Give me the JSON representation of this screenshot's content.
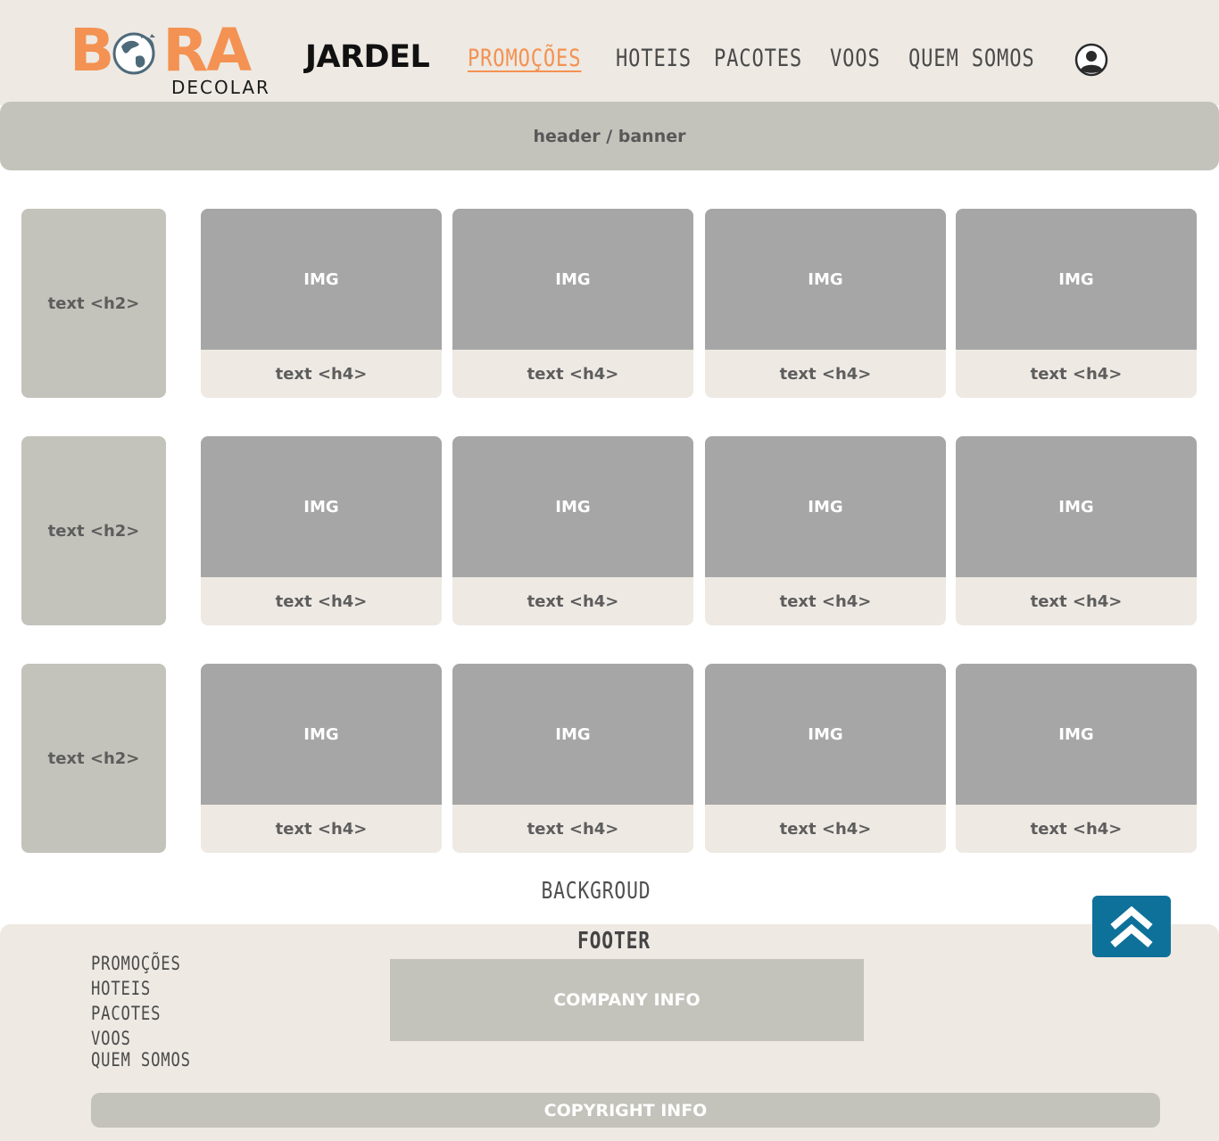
{
  "logo": {
    "word_left": "B",
    "word_right": "RA",
    "sub": "DECOLAR",
    "brand_color": "#f39252"
  },
  "brand": {
    "name": "JARDEL"
  },
  "nav": {
    "items": [
      "PROMOÇÕES",
      "HOTEIS",
      "PACOTES",
      "VOOS",
      "QUEM SOMOS"
    ],
    "active": "PROMOÇÕES",
    "user_icon": "user-circle-icon"
  },
  "banner": {
    "label": "header / banner"
  },
  "rows": [
    {
      "title": "text <h2>",
      "cards": [
        {
          "img": "IMG",
          "caption": "text <h4>"
        },
        {
          "img": "IMG",
          "caption": "text <h4>"
        },
        {
          "img": "IMG",
          "caption": "text <h4>"
        },
        {
          "img": "IMG",
          "caption": "text <h4>"
        }
      ]
    },
    {
      "title": "text <h2>",
      "cards": [
        {
          "img": "IMG",
          "caption": "text <h4>"
        },
        {
          "img": "IMG",
          "caption": "text <h4>"
        },
        {
          "img": "IMG",
          "caption": "text <h4>"
        },
        {
          "img": "IMG",
          "caption": "text <h4>"
        }
      ]
    },
    {
      "title": "text <h2>",
      "cards": [
        {
          "img": "IMG",
          "caption": "text <h4>"
        },
        {
          "img": "IMG",
          "caption": "text <h4>"
        },
        {
          "img": "IMG",
          "caption": "text <h4>"
        },
        {
          "img": "IMG",
          "caption": "text <h4>"
        }
      ]
    }
  ],
  "background_label": "BACKGROUD",
  "footer": {
    "title": "FOOTER",
    "links": [
      "PROMOÇÕES",
      "HOTEIS",
      "PACOTES",
      "VOOS",
      "QUEM SOMOS"
    ],
    "company": "COMPANY INFO",
    "copyright": "COPYRIGHT INFO"
  },
  "scroll_top": {
    "icon": "double-chevron-up-icon",
    "color": "#0e7199"
  },
  "colors": {
    "accent": "#f39252",
    "panel": "#c3c3bb",
    "surface": "#eee9e3",
    "image": "#a6a6a6"
  }
}
